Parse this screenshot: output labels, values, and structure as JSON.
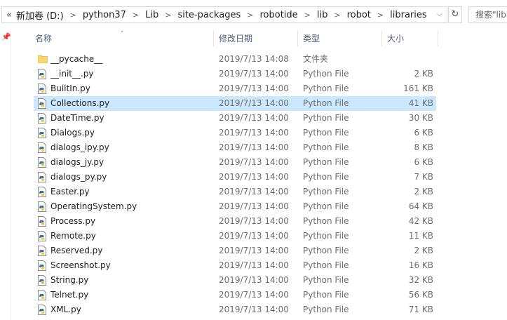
{
  "address": {
    "crumbs": [
      "新加卷 (D:)",
      "python37",
      "Lib",
      "site-packages",
      "robotide",
      "lib",
      "robot",
      "libraries"
    ],
    "back_glyph": "«",
    "search_placeholder": "搜索\"libr"
  },
  "columns": {
    "name": "名称",
    "date": "修改日期",
    "type": "类型",
    "size": "大小"
  },
  "files": [
    {
      "name": "__pycache__",
      "date": "2019/7/13 14:08",
      "type": "文件夹",
      "size": "",
      "icon": "folder-icon"
    },
    {
      "name": "__init__.py",
      "date": "2019/7/13 14:00",
      "type": "Python File",
      "size": "2 KB",
      "icon": "python-file-icon"
    },
    {
      "name": "BuiltIn.py",
      "date": "2019/7/13 14:00",
      "type": "Python File",
      "size": "161 KB",
      "icon": "python-file-icon"
    },
    {
      "name": "Collections.py",
      "date": "2019/7/13 14:00",
      "type": "Python File",
      "size": "41 KB",
      "icon": "python-file-icon",
      "selected": true
    },
    {
      "name": "DateTime.py",
      "date": "2019/7/13 14:00",
      "type": "Python File",
      "size": "30 KB",
      "icon": "python-file-icon"
    },
    {
      "name": "Dialogs.py",
      "date": "2019/7/13 14:00",
      "type": "Python File",
      "size": "6 KB",
      "icon": "python-file-icon"
    },
    {
      "name": "dialogs_ipy.py",
      "date": "2019/7/13 14:00",
      "type": "Python File",
      "size": "8 KB",
      "icon": "python-file-icon"
    },
    {
      "name": "dialogs_jy.py",
      "date": "2019/7/13 14:00",
      "type": "Python File",
      "size": "6 KB",
      "icon": "python-file-icon"
    },
    {
      "name": "dialogs_py.py",
      "date": "2019/7/13 14:00",
      "type": "Python File",
      "size": "7 KB",
      "icon": "python-file-icon"
    },
    {
      "name": "Easter.py",
      "date": "2019/7/13 14:00",
      "type": "Python File",
      "size": "2 KB",
      "icon": "python-file-icon"
    },
    {
      "name": "OperatingSystem.py",
      "date": "2019/7/13 14:00",
      "type": "Python File",
      "size": "64 KB",
      "icon": "python-file-icon"
    },
    {
      "name": "Process.py",
      "date": "2019/7/13 14:00",
      "type": "Python File",
      "size": "42 KB",
      "icon": "python-file-icon"
    },
    {
      "name": "Remote.py",
      "date": "2019/7/13 14:00",
      "type": "Python File",
      "size": "11 KB",
      "icon": "python-file-icon"
    },
    {
      "name": "Reserved.py",
      "date": "2019/7/13 14:00",
      "type": "Python File",
      "size": "2 KB",
      "icon": "python-file-icon"
    },
    {
      "name": "Screenshot.py",
      "date": "2019/7/13 14:00",
      "type": "Python File",
      "size": "16 KB",
      "icon": "python-file-icon"
    },
    {
      "name": "String.py",
      "date": "2019/7/13 14:00",
      "type": "Python File",
      "size": "32 KB",
      "icon": "python-file-icon"
    },
    {
      "name": "Telnet.py",
      "date": "2019/7/13 14:00",
      "type": "Python File",
      "size": "56 KB",
      "icon": "python-file-icon"
    },
    {
      "name": "XML.py",
      "date": "2019/7/13 14:00",
      "type": "Python File",
      "size": "71 KB",
      "icon": "python-file-icon"
    }
  ],
  "colors": {
    "selected_row": "#cce8ff",
    "header_text": "#4c607a",
    "folder": "#f8d775"
  }
}
